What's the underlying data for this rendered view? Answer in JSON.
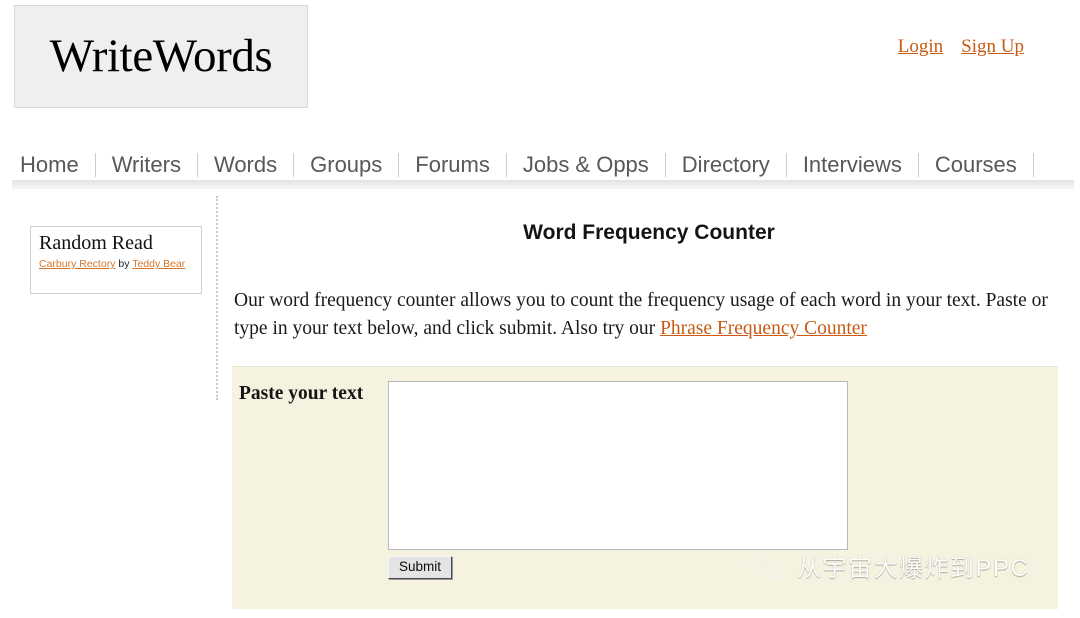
{
  "header": {
    "logo_text": "WriteWords",
    "auth_links": [
      {
        "label": "Login"
      },
      {
        "label": "Sign Up"
      }
    ]
  },
  "nav": {
    "items": [
      {
        "label": "Home"
      },
      {
        "label": "Writers"
      },
      {
        "label": "Words"
      },
      {
        "label": "Groups"
      },
      {
        "label": "Forums"
      },
      {
        "label": "Jobs & Opps"
      },
      {
        "label": "Directory"
      },
      {
        "label": "Interviews"
      },
      {
        "label": "Courses"
      }
    ]
  },
  "sidebar": {
    "random_read": {
      "title": "Random Read",
      "work_title": "Carbury Rectory",
      "by_word": "by",
      "author": "Teddy Bear"
    }
  },
  "main": {
    "page_title": "Word Frequency Counter",
    "intro_part1": "Our word frequency counter allows you to count the frequency usage of each word in your text. Paste or type in your text below, and click submit. Also try our ",
    "intro_link": "Phrase Frequency Counter",
    "form": {
      "paste_label": "Paste your text",
      "textarea_value": "",
      "textarea_placeholder": "",
      "submit_label": "Submit"
    }
  },
  "watermark": {
    "text": "从宇宙大爆炸到PPC",
    "icon": "wechat-icon"
  },
  "colors": {
    "link_orange": "#c85a14",
    "sidebar_link_orange": "#d4772e",
    "nav_text": "#585858",
    "form_background": "#f5f3e0",
    "logo_background": "#efefef"
  }
}
